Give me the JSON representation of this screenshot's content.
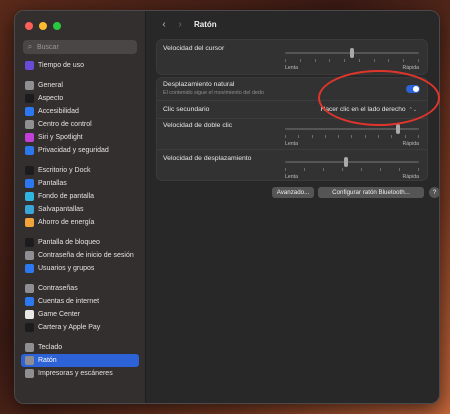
{
  "colors": {
    "accent": "#2d63d6",
    "annotation": "#e0352b",
    "close": "#ff5f57",
    "minimize": "#febc2e",
    "maximize": "#28c840"
  },
  "sidebar": {
    "search_placeholder": "Buscar",
    "groups": [
      [
        {
          "label": "Tiempo de uso",
          "icon": "hourglass-icon",
          "color": "#6a4bd8"
        }
      ],
      [
        {
          "label": "General",
          "icon": "gear-icon",
          "color": "#8e8e93"
        },
        {
          "label": "Aspecto",
          "icon": "appearance-icon",
          "color": "#1c1c1e"
        },
        {
          "label": "Accesibilidad",
          "icon": "accessibility-icon",
          "color": "#2b78f0"
        },
        {
          "label": "Centro de control",
          "icon": "control-center-icon",
          "color": "#8e8e93"
        },
        {
          "label": "Siri y Spotlight",
          "icon": "siri-icon",
          "color": "#c240d8"
        },
        {
          "label": "Privacidad y seguridad",
          "icon": "hand-icon",
          "color": "#2b78f0"
        }
      ],
      [
        {
          "label": "Escritorio y Dock",
          "icon": "dock-icon",
          "color": "#1c1c1e"
        },
        {
          "label": "Pantallas",
          "icon": "display-icon",
          "color": "#2b78f0"
        },
        {
          "label": "Fondo de pantalla",
          "icon": "wallpaper-icon",
          "color": "#2fb6e0"
        },
        {
          "label": "Salvapantallas",
          "icon": "screensaver-icon",
          "color": "#3aa6d8"
        },
        {
          "label": "Ahorro de energía",
          "icon": "energy-icon",
          "color": "#f2a33a"
        }
      ],
      [
        {
          "label": "Pantalla de bloqueo",
          "icon": "lock-screen-icon",
          "color": "#1c1c1e"
        },
        {
          "label": "Contraseña de inicio de sesión",
          "icon": "lock-icon",
          "color": "#8e8e93"
        },
        {
          "label": "Usuarios y grupos",
          "icon": "users-icon",
          "color": "#2b78f0"
        }
      ],
      [
        {
          "label": "Contraseñas",
          "icon": "key-icon",
          "color": "#8e8e93"
        },
        {
          "label": "Cuentas de internet",
          "icon": "at-icon",
          "color": "#2b78f0"
        },
        {
          "label": "Game Center",
          "icon": "game-center-icon",
          "color": "#e8e8e8"
        },
        {
          "label": "Cartera y Apple Pay",
          "icon": "wallet-icon",
          "color": "#1c1c1e"
        }
      ],
      [
        {
          "label": "Teclado",
          "icon": "keyboard-icon",
          "color": "#8e8e93"
        },
        {
          "label": "Ratón",
          "icon": "mouse-icon",
          "color": "#8e8e93",
          "active": true
        },
        {
          "label": "Impresoras y escáneres",
          "icon": "printer-icon",
          "color": "#8e8e93"
        }
      ]
    ]
  },
  "header": {
    "title": "Ratón",
    "back_icon": "chevron-left-icon",
    "forward_icon": "chevron-right-icon"
  },
  "settings": {
    "cursor_speed": {
      "label": "Velocidad del cursor",
      "min_label": "Lenta",
      "max_label": "Rápida",
      "value": 0.5
    },
    "natural_scroll": {
      "label": "Desplazamiento natural",
      "sublabel": "El contenido sigue el movimiento del dedo",
      "on": true
    },
    "secondary_click": {
      "label": "Clic secundario",
      "value": "Hacer clic en el lado derecho"
    },
    "double_click_speed": {
      "label": "Velocidad de doble clic",
      "min_label": "Lenta",
      "max_label": "Rápida",
      "value": 0.85
    },
    "scroll_speed": {
      "label": "Velocidad de desplazamiento",
      "min_label": "Lenta",
      "max_label": "Rápida",
      "value": 0.45
    }
  },
  "buttons": {
    "advanced": "Avanzado...",
    "bluetooth": "Configurar ratón Bluetooth...",
    "help": "?"
  }
}
